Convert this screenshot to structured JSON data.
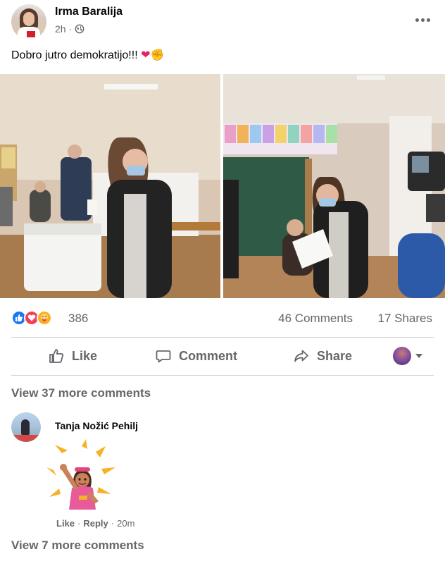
{
  "post": {
    "author": "Irma Baralija",
    "time": "2h",
    "separator": "·",
    "text": "Dobro jutro demokratijo!!!",
    "emoji_heart": "❤",
    "emoji_fist": "✊"
  },
  "reactions": {
    "count": "386",
    "icons": [
      "like-icon",
      "love-icon",
      "care-icon"
    ],
    "comments": "46 Comments",
    "shares": "17 Shares"
  },
  "actions": {
    "like": "Like",
    "comment": "Comment",
    "share": "Share"
  },
  "view_more_top": "View 37 more comments",
  "comment": {
    "author": "Tanja Nožić Pehilj",
    "like": "Like",
    "reply": "Reply",
    "dot": "·",
    "time": "20m"
  },
  "view_more_bottom": "View 7 more comments",
  "colors": {
    "text_primary": "#050505",
    "text_secondary": "#65676b",
    "like_blue": "#1877f2",
    "love_red": "#f33e58",
    "care_yellow": "#f7b125"
  }
}
